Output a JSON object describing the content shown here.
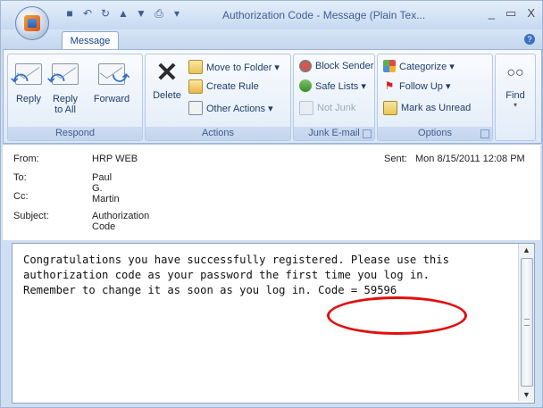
{
  "window": {
    "title": "Authorization Code - Message (Plain Tex...",
    "controls": [
      "_",
      "▭",
      "X"
    ]
  },
  "tabs": [
    {
      "label": "Message",
      "active": true
    }
  ],
  "ribbon": {
    "respond": {
      "label": "Respond",
      "reply": "Reply",
      "reply_all_line1": "Reply",
      "reply_all_line2": "to All",
      "forward": "Forward"
    },
    "actions": {
      "label": "Actions",
      "delete": "Delete",
      "move_to_folder": "Move to Folder ▾",
      "create_rule": "Create Rule",
      "other_actions": "Other Actions ▾"
    },
    "junk": {
      "label": "Junk E-mail",
      "block_sender": "Block Sender",
      "safe_lists": "Safe Lists ▾",
      "not_junk": "Not Junk"
    },
    "options": {
      "label": "Options",
      "categorize": "Categorize ▾",
      "follow_up": "Follow Up ▾",
      "mark_unread": "Mark as Unread"
    },
    "find": {
      "label": "Find"
    }
  },
  "header": {
    "from_label": "From:",
    "from_value": "HRP WEB",
    "to_label": "To:",
    "to_value": "Paul G. Martin",
    "cc_label": "Cc:",
    "subject_label": "Subject:",
    "subject_value": "Authorization Code",
    "sent_label": "Sent:",
    "sent_value": "Mon 8/15/2011 12:08 PM"
  },
  "body": {
    "line1": "Congratulations you have successfully registered. Please use this",
    "line2": "authorization code as your password the first time you log in.",
    "line3": "Remember to change it as soon as you log in. Code = 59596"
  },
  "colors": {
    "highlight_circle": "#e01010",
    "accent": "#15428b"
  }
}
